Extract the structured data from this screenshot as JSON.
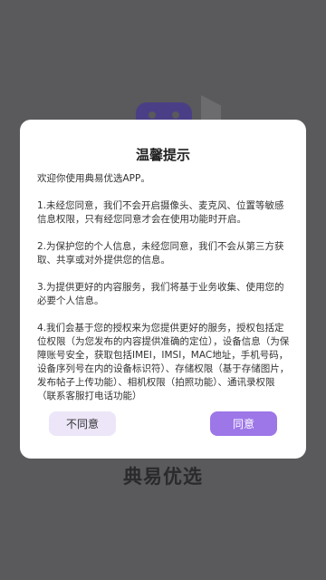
{
  "splash": {
    "app_name": "典易优选"
  },
  "dialog": {
    "title": "温馨提示",
    "paragraphs": [
      "欢迎你使用典易优选APP。",
      "1.未经您同意，我们不会开启摄像头、麦克风、位置等敏感信息权限，只有经您同意才会在使用功能时开启。",
      "2.为保护您的个人信息，未经您同意，我们不会从第三方获取、共享或对外提供您的信息。",
      "3.为提供更好的内容服务，我们将基于业务收集、使用您的必要个人信息。",
      "4.我们会基于您的授权来为您提供更好的服务，授权包括定位权限（为您发布的内容提供准确的定位），设备信息（为保障账号安全，获取包括IMEI，IMSI，MAC地址，手机号码，设备序列号在内的设备标识符）、存储权限（基于存储图片，发布帖子上传功能）、相机权限（拍照功能）、通讯录权限（联系客服打电话功能）"
    ],
    "decline_label": "不同意",
    "accept_label": "同意"
  }
}
